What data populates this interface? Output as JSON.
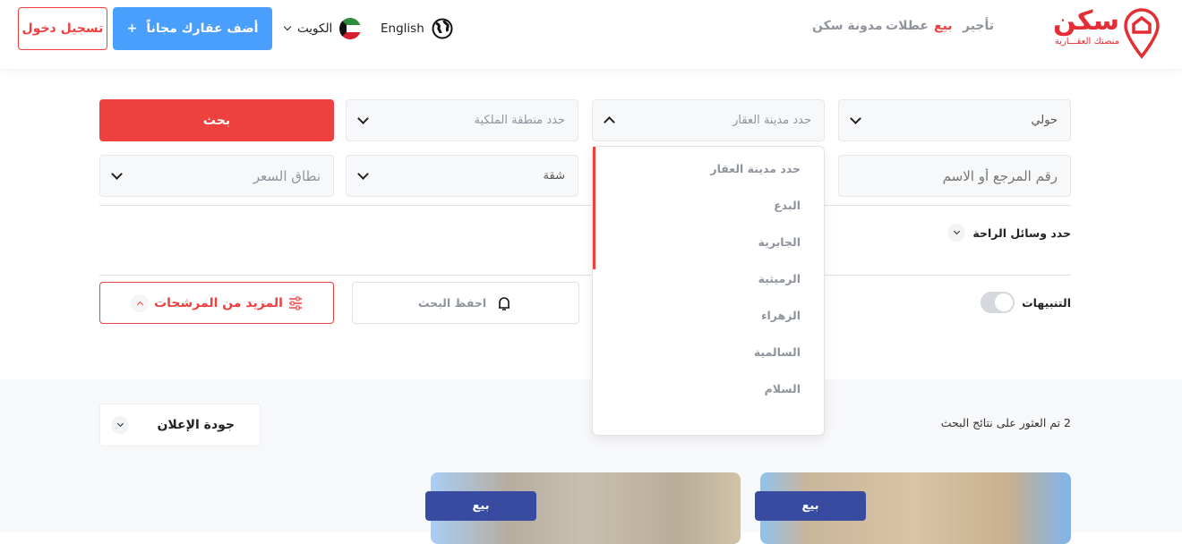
{
  "header": {
    "logo_text": "سكن",
    "logo_tagline": "منصتك العقـــارية",
    "nav": [
      {
        "label": "تأجير",
        "active": false
      },
      {
        "label": "بيع",
        "active": true
      },
      {
        "label": "عطلات",
        "active": false
      },
      {
        "label": "مدونة سكن",
        "active": false
      }
    ],
    "language": "English",
    "country": "الكويت",
    "add_property": "أضف عقارك مجاناً",
    "add_icon": "+",
    "login": "تسجيل دخول"
  },
  "search": {
    "governorate": "حولي",
    "city_placeholder": "حدد مدينة العقار",
    "ownership_placeholder": "حدد منطقة الملكية",
    "search_button": "بحث",
    "reference_placeholder": "رقم المرجع أو الاسم",
    "property_type": "شقة",
    "price_placeholder": "نطاق السعر",
    "amenities": "حدد وسائل الراحة",
    "alerts": "التنبيهات",
    "alerts_on": false,
    "save_search": "احفظ البحث",
    "more_filters": "المزيد من المرشحات"
  },
  "city_dropdown": {
    "options": [
      "حدد مدينة العقار",
      "البدع",
      "الجابرية",
      "الرميثية",
      "الزهراء",
      "السالمية",
      "السلام"
    ]
  },
  "results": {
    "count_text": "2 تم العثور على نتائج البحث",
    "sort": "جودة الإعلان",
    "cards": [
      {
        "badge": "بيع"
      },
      {
        "badge": "بيع"
      }
    ]
  },
  "colors": {
    "brand_red": "#ef4040",
    "blue": "#4a9efc",
    "badge": "#394ba0"
  }
}
